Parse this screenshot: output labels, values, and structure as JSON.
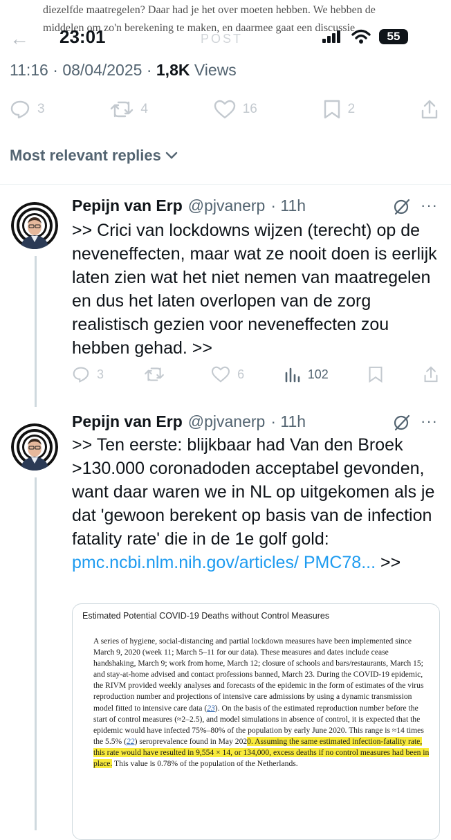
{
  "bleed_lines": [
    "diezelfde maatregelen? Daar had je het over moeten hebben. We hebben de",
    "middelen om zo'n berekening te maken, en daarmee gaat een discussie"
  ],
  "status": {
    "time": "23:01",
    "battery": "55"
  },
  "header": {
    "title": "Post"
  },
  "post_meta": {
    "time": "11:16",
    "date": "08/04/2025",
    "views_count": "1,8K",
    "views_label": "Views",
    "sep": "·"
  },
  "post_actions": {
    "replies": "3",
    "reposts": "4",
    "likes": "16",
    "bookmarks": "2"
  },
  "replies_sort": {
    "label": "Most relevant replies"
  },
  "replies": [
    {
      "name": "Pepijn van Erp",
      "handle": "@pjvanerp",
      "time": "· 11h",
      "text": ">> Crici van lockdowns wijzen (terecht) op de neveneffecten, maar wat ze nooit doen is eerlijk laten zien wat het niet nemen van maatregelen en dus het laten overlopen van de zorg realistisch gezien voor neveneffecten zou hebben gehad. >>",
      "replies": "3",
      "reposts": "",
      "likes": "6",
      "views": "102"
    },
    {
      "name": "Pepijn van Erp",
      "handle": "@pjvanerp",
      "time": "· 11h",
      "text": ">> Ten eerste: blijkbaar had Van den Broek >130.000 coronadoden acceptabel gevonden, want daar waren we in NL op uitgekomen als je dat 'gewoon berekent op basis van de infection fatality rate' die in de 1e golf gold:",
      "link": "pmc.ncbi.nlm.nih.gov/articles/ PMC78...",
      "tail": ">>"
    }
  ],
  "card": {
    "title": "Estimated Potential COVID-19 Deaths without Control Measures",
    "p1": "A series of hygiene, social-distancing and partial lockdown measures have been implemented since March 9, 2020 (week 11; March 5–11 for our data). These measures and dates include cease handshaking, March 9; work from home, March 12; closure of schools and bars/restaurants, March 15; and stay-at-home advised and contact professions banned, March 23. During the COVID-19 epidemic, the RIVM provided weekly analyses and forecasts of the epidemic in the form of estimates of the virus reproduction number and projections of intensive care admissions by using a dynamic transmission model fitted to intensive care data (",
    "cite1": "23",
    "p2": "). On the basis of the estimated reproduction number before the start of control measures (≈2–2.5), and model simulations in absence of control, it is expected that the epidemic would have infected 75%–80% of the population by early June 2020. This range is ≈14 times the 5.5% (",
    "cite2": "22",
    "p3": ") seroprevalence found in May 202",
    "highlight": "0. Assuming the same estimated infection-fatality rate, this rate would have resulted in 9,554 × 14, or 134,000, excess deaths if no control measures had been in place.",
    "p4": " This value is 0.78% of the population of the Netherlands."
  },
  "colors": {
    "text": "#0f1419",
    "muted": "#536471",
    "link": "#1d9bf0",
    "highlight": "#f8ea3c"
  }
}
